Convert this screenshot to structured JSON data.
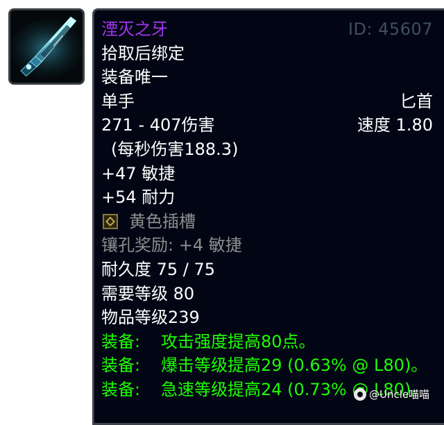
{
  "item": {
    "name": "湮灭之牙",
    "id_label": "ID: 45607",
    "binding": "拾取后绑定",
    "unique": "装备唯一",
    "slot": "单手",
    "weapon_type": "匕首",
    "damage": "271 - 407伤害",
    "speed": "速度 1.80",
    "dps": "(每秒伤害188.3)",
    "stats": [
      "+47 敏捷",
      "+54 耐力"
    ],
    "socket": {
      "icon": "yellow-socket-icon",
      "label": "黄色插槽"
    },
    "socket_bonus": "镶孔奖励: +4 敏捷",
    "durability": "耐久度 75 / 75",
    "required_level": "需要等级 80",
    "item_level": "物品等级239",
    "equip_effects": [
      {
        "label": "装备:",
        "text": "攻击强度提高80点。"
      },
      {
        "label": "装备:",
        "text": "爆击等级提高29 (0.63% @ L80)。"
      },
      {
        "label": "装备:",
        "text": "急速等级提高24 (0.73% @ L80)。"
      }
    ]
  },
  "icon": {
    "name": "dagger-icon"
  },
  "watermark": {
    "text": "@Uncle喵喵"
  },
  "colors": {
    "epic": "#a335ee",
    "equip_green": "#1eff00",
    "inactive_gray": "#8e8e8e",
    "tooltip_bg": "#020514"
  }
}
